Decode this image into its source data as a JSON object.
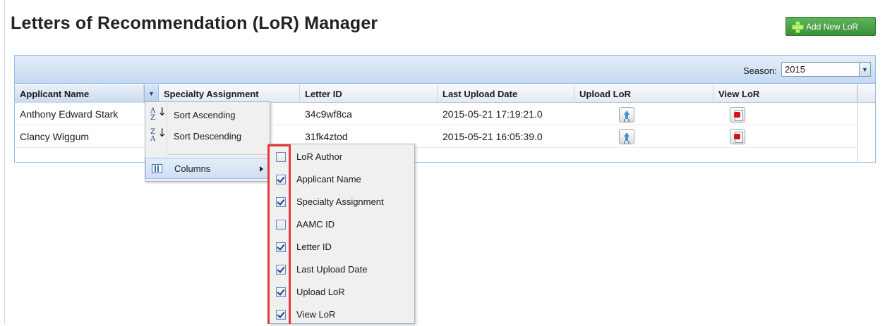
{
  "page": {
    "title": "Letters of Recommendation (LoR) Manager"
  },
  "toolbar": {
    "add_label": "Add New LoR"
  },
  "season": {
    "label": "Season:",
    "value": "2015"
  },
  "grid": {
    "columns": [
      "Applicant Name",
      "Specialty Assignment",
      "Letter ID",
      "Last Upload Date",
      "Upload LoR",
      "View LoR"
    ],
    "rows": [
      {
        "applicant": "Anthony Edward Stark",
        "letter_id": "34c9wf8ca",
        "date": "2015-05-21 17:19:21.0"
      },
      {
        "applicant": "Clancy Wiggum",
        "letter_id": "31fk4ztod",
        "date": "2015-05-21 16:05:39.0"
      }
    ]
  },
  "context_menu": {
    "sort_asc": "Sort Ascending",
    "sort_desc": "Sort Descending",
    "columns": "Columns"
  },
  "columns_menu": {
    "items": [
      {
        "label": "LoR Author",
        "checked": false
      },
      {
        "label": "Applicant Name",
        "checked": true
      },
      {
        "label": "Specialty Assignment",
        "checked": true
      },
      {
        "label": "AAMC ID",
        "checked": false
      },
      {
        "label": "Letter ID",
        "checked": true
      },
      {
        "label": "Last Upload Date",
        "checked": true
      },
      {
        "label": "Upload LoR",
        "checked": true
      },
      {
        "label": "View LoR",
        "checked": true
      }
    ]
  },
  "colors": {
    "accent": "#3a8f38",
    "highlight": "#e53935",
    "grid_border": "#99bbe8"
  }
}
